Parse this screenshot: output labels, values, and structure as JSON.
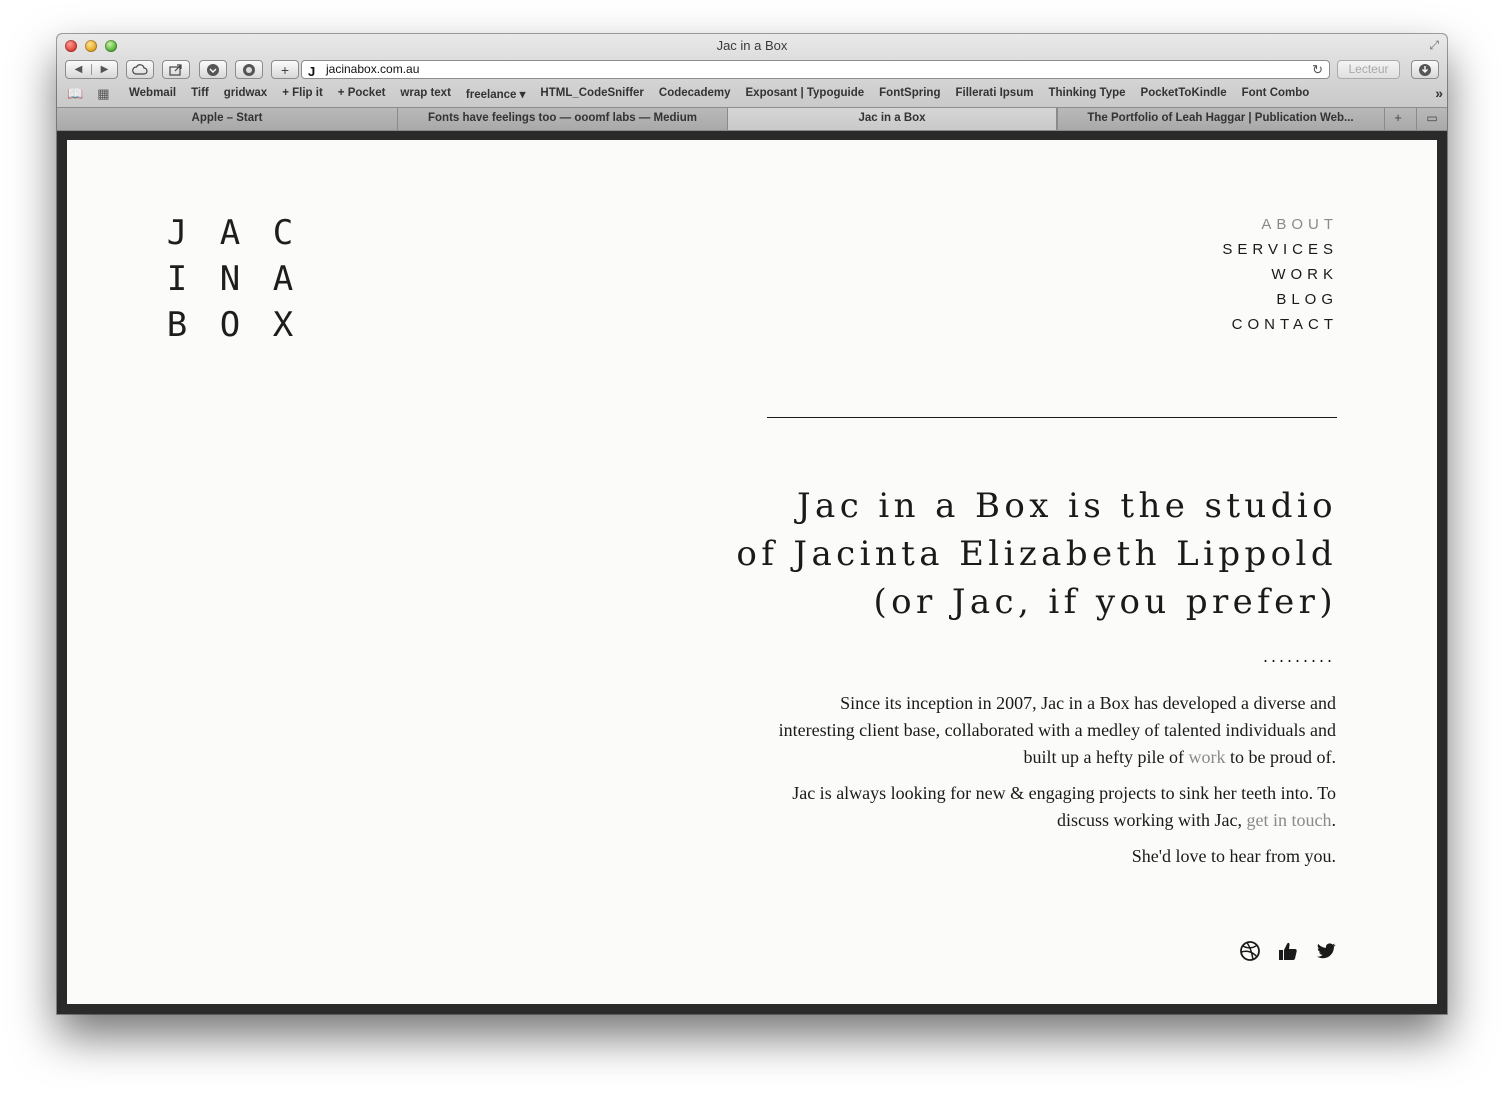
{
  "window": {
    "title": "Jac in a Box"
  },
  "toolbar": {
    "url": "jacinabox.com.au",
    "reader_label": "Lecteur"
  },
  "bookmarks": [
    "Webmail",
    "Tiff",
    "gridwax",
    "+ Flip it",
    "+ Pocket",
    "wrap text",
    "freelance ▾",
    "HTML_CodeSniffer",
    "Codecademy",
    "Exposant | Typoguide",
    "FontSpring",
    "Fillerati Ipsum",
    "Thinking Type",
    "PocketToKindle",
    "Font Combo"
  ],
  "tabs": [
    {
      "label": "Apple – Start",
      "active": false
    },
    {
      "label": "Fonts have feelings too — ooomf labs — Medium",
      "active": false
    },
    {
      "label": "Jac in a Box",
      "active": true
    },
    {
      "label": "The Portfolio of Leah Haggar | Publication Web...",
      "active": false
    }
  ],
  "page": {
    "logo": [
      [
        "J",
        "A",
        "C"
      ],
      [
        "I",
        "N",
        "A"
      ],
      [
        "B",
        "O",
        "X"
      ]
    ],
    "nav": [
      {
        "label": "ABOUT",
        "current": true
      },
      {
        "label": "SERVICES",
        "current": false
      },
      {
        "label": "WORK",
        "current": false
      },
      {
        "label": "BLOG",
        "current": false
      },
      {
        "label": "CONTACT",
        "current": false
      }
    ],
    "headline": [
      "Jac in a Box is the studio",
      "of Jacinta Elizabeth Lippold",
      "(or Jac, if you prefer)"
    ],
    "dots": ".........",
    "para1_before": "Since its inception in 2007, Jac in a Box has developed a diverse and interesting client base, collaborated with a medley of talented individuals and built up a hefty pile of ",
    "para1_link": "work",
    "para1_after": " to be proud of.",
    "para2_before": "Jac is always looking for new & engaging projects to sink her teeth into. To discuss working with Jac, ",
    "para2_link": "get in touch",
    "para2_after": ".",
    "para3": "She'd love to hear from you.",
    "social_icons": [
      "dribbble-icon",
      "thumbs-up-icon",
      "twitter-icon"
    ],
    "colors": {
      "background": "#fbfbf9",
      "text": "#1a1a1a",
      "link": "#8a8a8a"
    }
  }
}
